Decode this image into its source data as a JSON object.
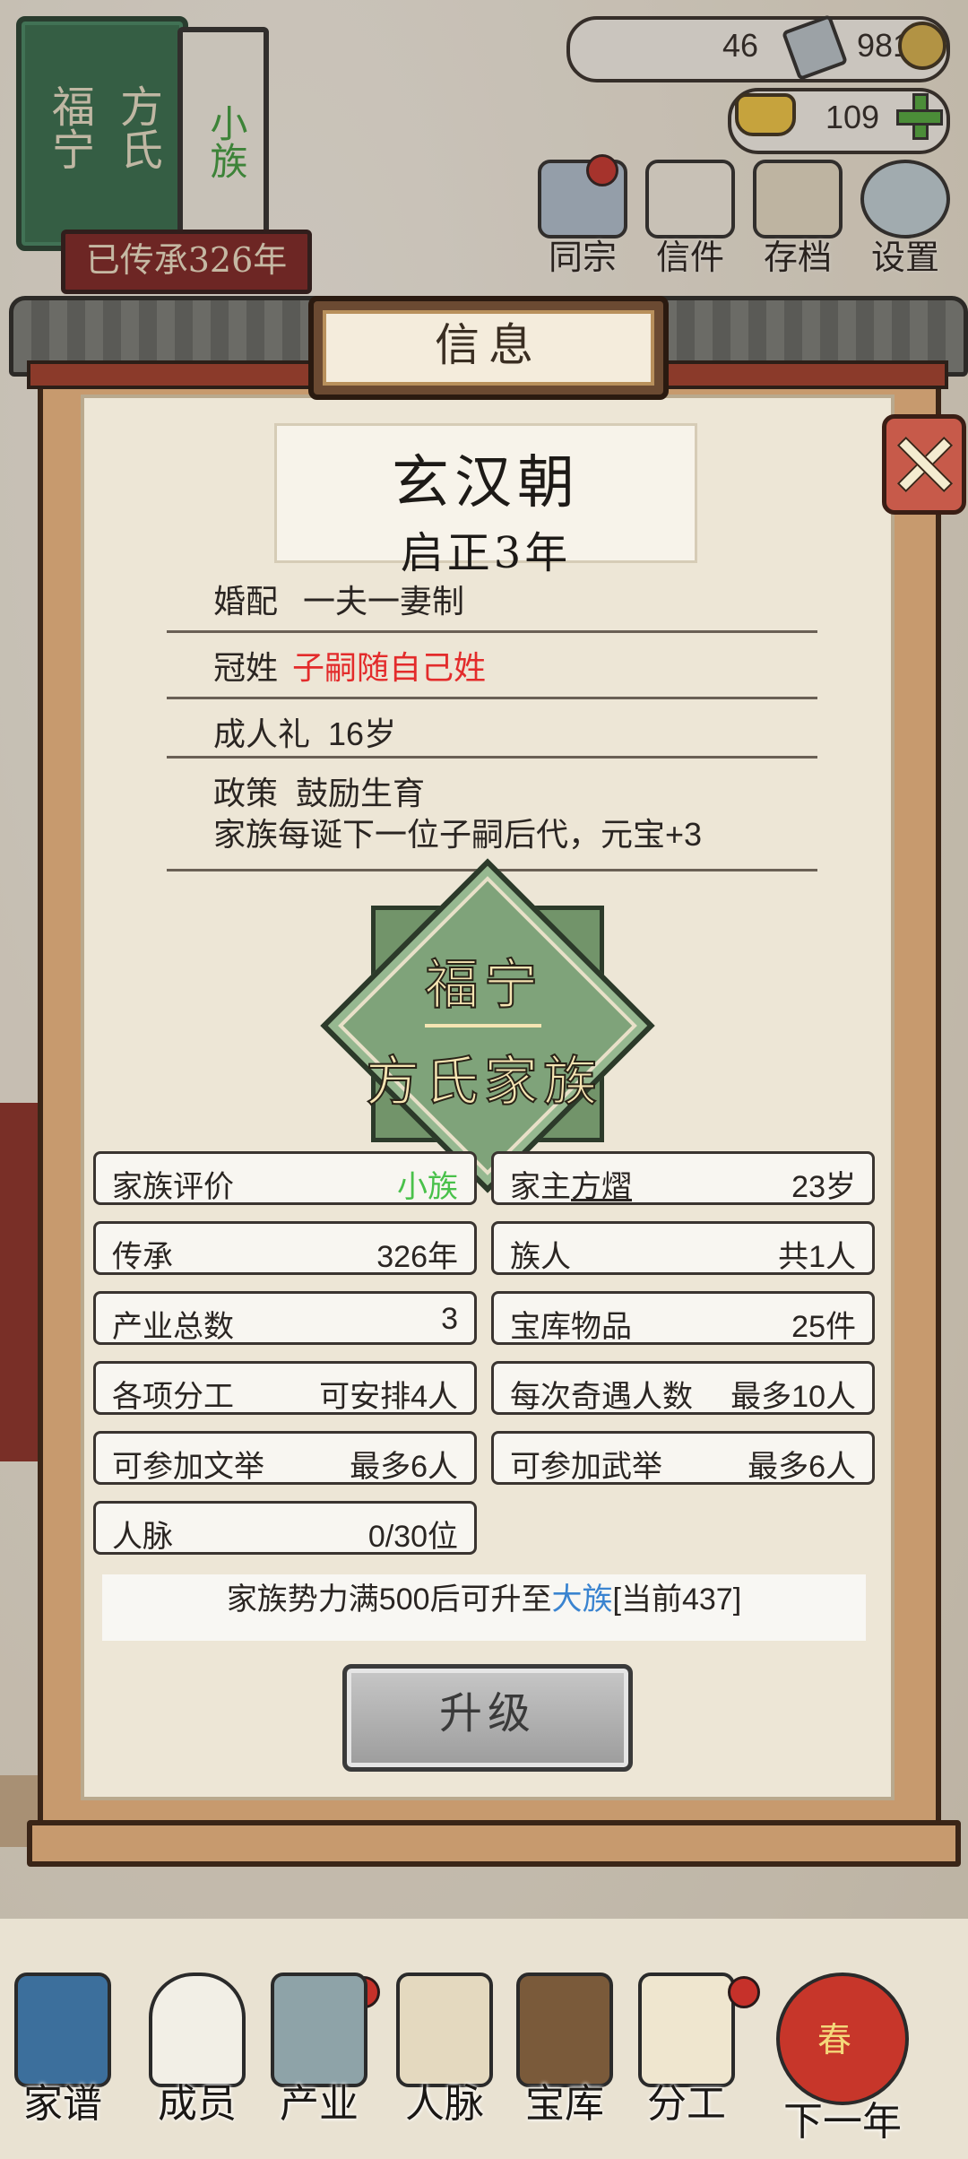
{
  "hud": {
    "book_title_left": "福宁",
    "book_title_right": "方氏",
    "book_tag": "小族",
    "inheritance_banner": "已传承326年",
    "jade_count": "46",
    "coin_count": "981",
    "ingot_count": "109"
  },
  "top_nav": [
    {
      "label": "同宗",
      "icon": "clan-icon"
    },
    {
      "label": "信件",
      "icon": "letter-icon"
    },
    {
      "label": "存档",
      "icon": "archive-icon"
    },
    {
      "label": "设置",
      "icon": "settings-gear-icon"
    }
  ],
  "modal": {
    "title": "信息",
    "dynasty": "玄汉朝",
    "year": "启正3年",
    "marriage": {
      "label": "婚配",
      "value": "一夫一妻制"
    },
    "surname": {
      "label": "冠姓",
      "value": "子嗣随自己姓"
    },
    "coming_of_age": {
      "label": "成人礼",
      "value": "16岁"
    },
    "policy": {
      "label": "政策",
      "value": "鼓励生育",
      "desc": "家族每诞下一位子嗣后代，元宝+3"
    },
    "emblem": {
      "line1": "福宁",
      "line2": "方氏家族"
    },
    "stats": [
      {
        "k": "家族评价",
        "v": "小族"
      },
      {
        "k": "家主",
        "name": "方熠",
        "v": "23岁"
      },
      {
        "k": "传承",
        "v": "326年"
      },
      {
        "k": "族人",
        "v": "共1人"
      },
      {
        "k": "产业总数",
        "v": "3"
      },
      {
        "k": "宝库物品",
        "v": "25件"
      },
      {
        "k": "各项分工",
        "v": "可安排4人"
      },
      {
        "k": "每次奇遇人数",
        "v": "最多10人"
      },
      {
        "k": "可参加文举",
        "v": "最多6人"
      },
      {
        "k": "可参加武举",
        "v": "最多6人"
      },
      {
        "k": "人脉",
        "v": "0/30位"
      }
    ],
    "notice_pre": "家族势力满500后可升至",
    "notice_highlight": "大族",
    "notice_post": "[当前437]",
    "upgrade_label": "升级"
  },
  "bottom_nav": [
    {
      "label": "家谱"
    },
    {
      "label": "成员"
    },
    {
      "label": "产业"
    },
    {
      "label": "人脉"
    },
    {
      "label": "宝库"
    },
    {
      "label": "分工"
    },
    {
      "label": "下一年",
      "lantern": "春"
    }
  ],
  "colors": {
    "accent_red": "#e32b2b",
    "accent_green": "#49c14a",
    "accent_blue": "#3a84d0"
  }
}
